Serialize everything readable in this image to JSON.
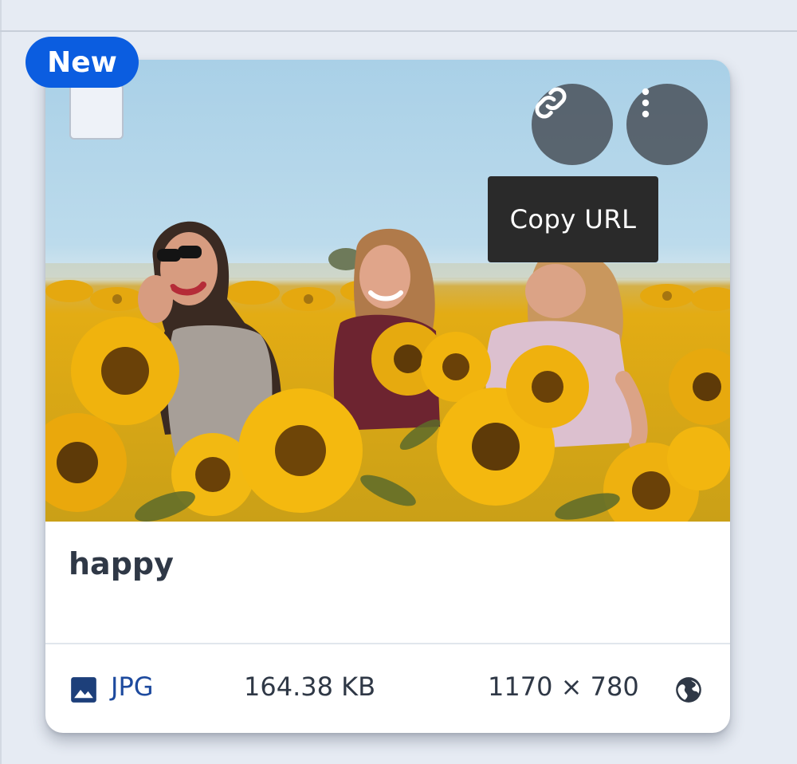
{
  "asset": {
    "badge": "New",
    "title": "happy",
    "image_alt": "happy",
    "file_type": "JPG",
    "file_size": "164.38 KB",
    "dimensions": "1170 × 780"
  },
  "actions": {
    "copy_url_tooltip": "Copy URL"
  },
  "icons": {
    "copy_url": "link-icon",
    "more": "more-vertical-icon",
    "file_type": "image-icon",
    "visibility": "globe-icon"
  },
  "colors": {
    "badge": "#0b5de0",
    "file_type_text": "#1d4a9e",
    "title_text": "#2f3846",
    "tooltip_bg": "#2a2a2a",
    "page_bg": "#e6ebf3"
  }
}
